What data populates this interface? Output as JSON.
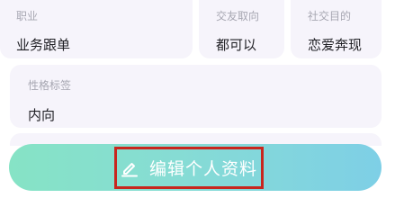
{
  "profile": {
    "job": {
      "label": "职业",
      "value": "业务跟单"
    },
    "preference": {
      "label": "交友取向",
      "value": "都可以"
    },
    "goal": {
      "label": "社交目的",
      "value": "恋爱奔现"
    },
    "tags": {
      "label": "性格标签",
      "value": "内向"
    }
  },
  "edit_button": {
    "label": "编辑个人资料",
    "icon": "pencil-icon"
  },
  "colors": {
    "card_bg": "#f6f4fb",
    "label_color": "#a7a7b2",
    "value_color": "#1f1f24",
    "button_gradient_start": "#86e3c5",
    "button_gradient_end": "#7ecfe6",
    "highlight_border": "#c8261e"
  }
}
